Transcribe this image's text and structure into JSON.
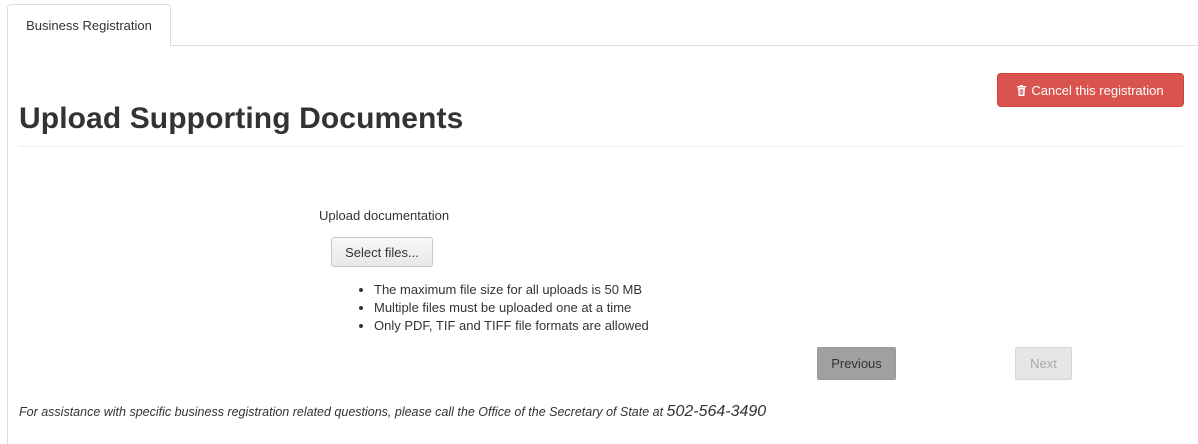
{
  "tabs": [
    {
      "label": "Business Registration"
    }
  ],
  "header": {
    "cancel_label": "Cancel this registration",
    "title": "Upload Supporting Documents"
  },
  "upload": {
    "label": "Upload documentation",
    "select_label": "Select files...",
    "rules": [
      "The maximum file size for all uploads is 50 MB",
      "Multiple files must be uploaded one at a time",
      "Only PDF, TIF and TIFF file formats are allowed"
    ]
  },
  "nav": {
    "previous_label": "Previous",
    "next_label": "Next"
  },
  "footer": {
    "assist_text": "For assistance with specific business registration related questions, please call the Office of the Secretary of State at ",
    "phone": "502-564-3490"
  },
  "colors": {
    "danger": "#d9534f",
    "border": "#dddddd",
    "previous_bg": "#a0a0a0",
    "next_disabled_bg": "#e6e6e6"
  },
  "icons": {
    "cancel": "trash-icon"
  }
}
